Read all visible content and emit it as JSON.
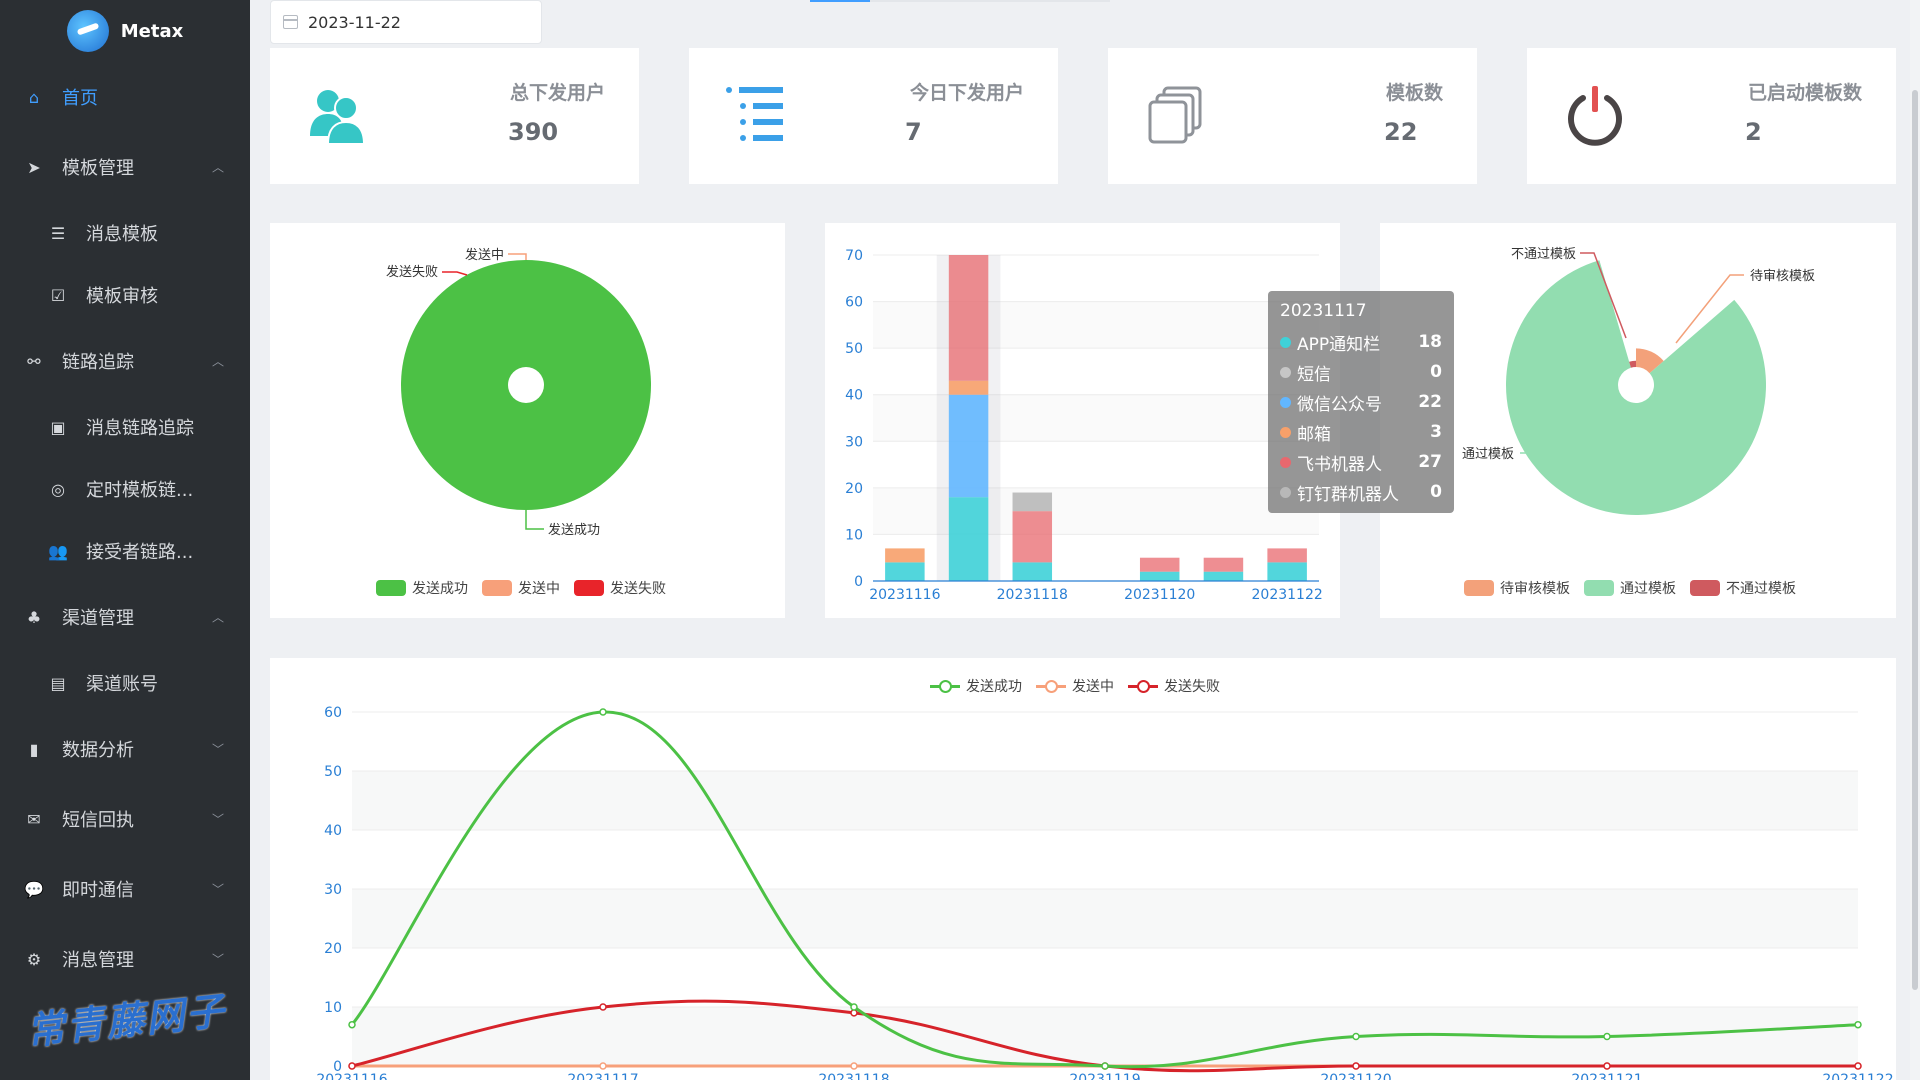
{
  "app": {
    "name": "Metax"
  },
  "sidebar": {
    "items": [
      {
        "label": "首页",
        "icon": "home-icon",
        "active": true
      },
      {
        "label": "模板管理",
        "icon": "send-icon",
        "caret": "up"
      },
      {
        "label": "消息模板",
        "icon": "list-icon",
        "sub": true
      },
      {
        "label": "模板审核",
        "icon": "checkbox-icon",
        "sub": true
      },
      {
        "label": "链路追踪",
        "icon": "share-icon",
        "caret": "up"
      },
      {
        "label": "消息链路追踪",
        "icon": "image-icon",
        "sub": true
      },
      {
        "label": "定时模板链...",
        "icon": "target-icon",
        "sub": true
      },
      {
        "label": "接受者链路...",
        "icon": "users-icon",
        "sub": true
      },
      {
        "label": "渠道管理",
        "icon": "cluster-icon",
        "caret": "up"
      },
      {
        "label": "渠道账号",
        "icon": "account-icon",
        "sub": true
      },
      {
        "label": "数据分析",
        "icon": "bar-chart-icon",
        "caret": "down"
      },
      {
        "label": "短信回执",
        "icon": "sms-icon",
        "caret": "down"
      },
      {
        "label": "即时通信",
        "icon": "chat-icon",
        "caret": "down"
      },
      {
        "label": "消息管理",
        "icon": "message-icon",
        "caret": "down"
      }
    ]
  },
  "date_picker": {
    "value": "2023-11-22"
  },
  "stats": [
    {
      "label": "总下发用户",
      "value": "390",
      "icon": "users-icon",
      "color": "#36c6c6"
    },
    {
      "label": "今日下发用户",
      "value": "7",
      "icon": "list-icon",
      "color": "#3ba0e8"
    },
    {
      "label": "模板数",
      "value": "22",
      "icon": "copy-icon",
      "color": "#8f9399"
    },
    {
      "label": "已启动模板数",
      "value": "2",
      "icon": "power-icon",
      "color": "#e25151"
    }
  ],
  "pie_status": {
    "labels": {
      "sending": "发送中",
      "failed": "发送失败",
      "success": "发送成功"
    },
    "legend": [
      "发送成功",
      "发送中",
      "发送失败"
    ],
    "colors": [
      "#4cc145",
      "#f7a07a",
      "#e8242a"
    ]
  },
  "bar_chart": {
    "tooltip": {
      "title": "20231117",
      "rows": [
        {
          "name": "APP通知栏",
          "value": "18",
          "color": "#3fd1d8"
        },
        {
          "name": "短信",
          "value": "0",
          "color": "#c6c6c6"
        },
        {
          "name": "微信公众号",
          "value": "22",
          "color": "#62b7ff"
        },
        {
          "name": "邮箱",
          "value": "3",
          "color": "#f7a06a"
        },
        {
          "name": "飞书机器人",
          "value": "27",
          "color": "#e8686e"
        },
        {
          "name": "钉钉群机器人",
          "value": "0",
          "color": "#b8b8b8"
        }
      ]
    }
  },
  "pie_templates": {
    "labels": {
      "rejected": "不通过模板",
      "pending": "待审核模板",
      "passed": "通过模板"
    },
    "legend": [
      "待审核模板",
      "通过模板",
      "不通过模板"
    ],
    "colors": [
      "#f3a17a",
      "#92ddb0",
      "#cf5a5f"
    ]
  },
  "line_legend": [
    "发送成功",
    "发送中",
    "发送失败"
  ],
  "chart_data": [
    {
      "type": "pie",
      "title": "",
      "categories": [
        "发送成功",
        "发送中",
        "发送失败"
      ],
      "values": [
        390,
        0,
        0
      ]
    },
    {
      "type": "bar",
      "stacked": true,
      "categories": [
        "20231116",
        "20231117",
        "20231118",
        "20231119",
        "20231120",
        "20231121",
        "20231122"
      ],
      "tick_labels": [
        "20231116",
        "20231118",
        "20231120",
        "20231122"
      ],
      "ylim": [
        0,
        70
      ],
      "yticks": [
        0,
        10,
        20,
        30,
        40,
        50,
        60,
        70
      ],
      "series": [
        {
          "name": "APP通知栏",
          "values": [
            4,
            18,
            4,
            0,
            2,
            2,
            4
          ]
        },
        {
          "name": "短信",
          "values": [
            0,
            0,
            0,
            0,
            0,
            0,
            0
          ]
        },
        {
          "name": "微信公众号",
          "values": [
            0,
            22,
            0,
            0,
            0,
            0,
            0
          ]
        },
        {
          "name": "邮箱",
          "values": [
            3,
            3,
            0,
            0,
            0,
            0,
            0
          ]
        },
        {
          "name": "飞书机器人",
          "values": [
            0,
            27,
            11,
            0,
            3,
            3,
            3
          ]
        },
        {
          "name": "钉钉群机器人",
          "values": [
            0,
            0,
            4,
            0,
            0,
            0,
            0
          ]
        }
      ]
    },
    {
      "type": "pie",
      "title": "",
      "categories": [
        "待审核模板",
        "通过模板",
        "不通过模板"
      ],
      "values": [
        3,
        18,
        1
      ]
    },
    {
      "type": "line",
      "x": [
        "20231116",
        "20231117",
        "20231118",
        "20231119",
        "20231120",
        "20231121",
        "20231122"
      ],
      "ylim": [
        0,
        60
      ],
      "yticks": [
        0,
        10,
        20,
        30,
        40,
        50,
        60
      ],
      "series": [
        {
          "name": "发送成功",
          "values": [
            7,
            60,
            10,
            0,
            5,
            5,
            7
          ],
          "color": "#4cc145"
        },
        {
          "name": "发送中",
          "values": [
            0,
            0,
            0,
            0,
            0,
            0,
            0
          ],
          "color": "#f7a07a"
        },
        {
          "name": "发送失败",
          "values": [
            0,
            10,
            9,
            0,
            0,
            0,
            0
          ],
          "color": "#d6232a"
        }
      ]
    }
  ],
  "watermark": "常青藤网子"
}
